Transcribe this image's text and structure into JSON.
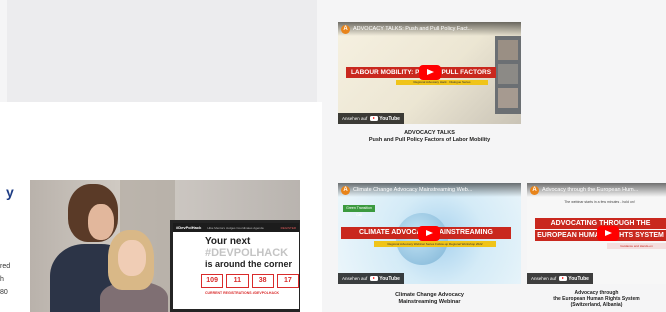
{
  "page": {
    "left_fragment": "y",
    "body_lines": [
      "red",
      "h",
      "80"
    ]
  },
  "hackathon_photo": {
    "screen": {
      "brand": "#DevPolHack",
      "menu": "Hike  Mentors  Judges  Coordinates  Agenda",
      "register": "REGISTER",
      "headline_1": "Your next",
      "headline_2": "#DEVPOLHACK",
      "headline_3": "is around the corner",
      "countdown": [
        "109",
        "11",
        "38",
        "17"
      ],
      "current_registrations": "CURRENT REGISTRATIONS #DEVPOLHACK"
    }
  },
  "videos": [
    {
      "title": "ADVOCACY TALKS: Push and Pull Policy Fact...",
      "channel_initial": "A",
      "banner": "LABOUR MOBILITY: PUSH & PULL FACTORS",
      "sub_banner": "Regional Advocacy Hack · Dialogue Series",
      "watch_on": "Ansehen auf",
      "youtube": "YouTube",
      "caption": [
        "ADVOCACY TALKS",
        "Push and Pull Policy Factors of Labor Mobility"
      ]
    },
    {
      "title": "Climate Change Advocacy Mainstreaming Web...",
      "channel_initial": "A",
      "badge": "Green Transition Call",
      "banner": "CLIMATE ADVOCACY MAINSTREAMING",
      "sub_banner": "Regional Advocacy Webinar Series Follow-up Regional Workshop 2022",
      "watch_on": "Ansehen auf",
      "youtube": "YouTube",
      "caption": [
        "Climate Change Advocacy",
        "Mainstreaming Webinar"
      ]
    },
    {
      "title": "Advocacy through the European Hum...",
      "channel_initial": "A",
      "top_note": "The webinar starts in a few minutes - hold on!",
      "banner_1": "ADVOCATING THROUGH THE",
      "banner_2": "EUROPEAN HUMAN RIGHTS SYSTEM",
      "sub_banner": "Guidance and Hands-on",
      "watch_on": "Ansehen auf",
      "youtube": "YouTube",
      "caption": [
        "Advocacy through",
        "the European Human Rights System",
        "(Switzerland, Albania)"
      ]
    }
  ],
  "colors": {
    "brand_red": "#c9281e",
    "accent_blue": "#1d3c84",
    "youtube_red": "#ff0000"
  }
}
